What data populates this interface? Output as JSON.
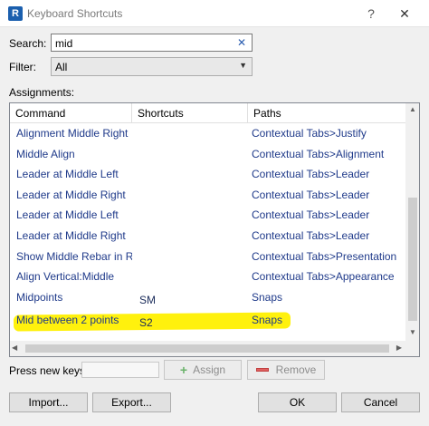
{
  "window": {
    "title": "Keyboard Shortcuts",
    "app_icon_letter": "R",
    "help": "?",
    "close": "✕"
  },
  "search": {
    "label": "Search:",
    "value": "mid",
    "clear": "✕"
  },
  "filter": {
    "label": "Filter:",
    "value": "All"
  },
  "assignments": {
    "label": "Assignments:",
    "columns": [
      "Command",
      "Shortcuts",
      "Paths"
    ],
    "rows": [
      {
        "command": "Alignment Middle Right",
        "shortcut": "",
        "path": "Contextual Tabs>Justify"
      },
      {
        "command": "Middle Align",
        "shortcut": "",
        "path": "Contextual Tabs>Alignment"
      },
      {
        "command": "Leader at Middle Left",
        "shortcut": "",
        "path": "Contextual Tabs>Leader"
      },
      {
        "command": "Leader at Middle Right",
        "shortcut": "",
        "path": "Contextual Tabs>Leader"
      },
      {
        "command": "Leader at Middle Left",
        "shortcut": "",
        "path": "Contextual Tabs>Leader"
      },
      {
        "command": "Leader at Middle Right",
        "shortcut": "",
        "path": "Contextual Tabs>Leader"
      },
      {
        "command": "Show Middle Rebar in R...",
        "shortcut": "",
        "path": "Contextual Tabs>Presentation"
      },
      {
        "command": "Align Vertical:Middle",
        "shortcut": "",
        "path": "Contextual Tabs>Appearance"
      },
      {
        "command": "Midpoints",
        "shortcut": "SM",
        "path": "Snaps"
      },
      {
        "command": "Mid between 2 points",
        "shortcut": "S2",
        "path": "Snaps"
      }
    ]
  },
  "press_keys": {
    "label": "Press new keys:",
    "value": ""
  },
  "buttons": {
    "assign": "Assign",
    "remove": "Remove",
    "import": "Import...",
    "export": "Export...",
    "ok": "OK",
    "cancel": "Cancel"
  },
  "colors": {
    "highlight": "#fff000",
    "link_text": "#1f3a8a",
    "app_icon": "#1b5fae"
  }
}
